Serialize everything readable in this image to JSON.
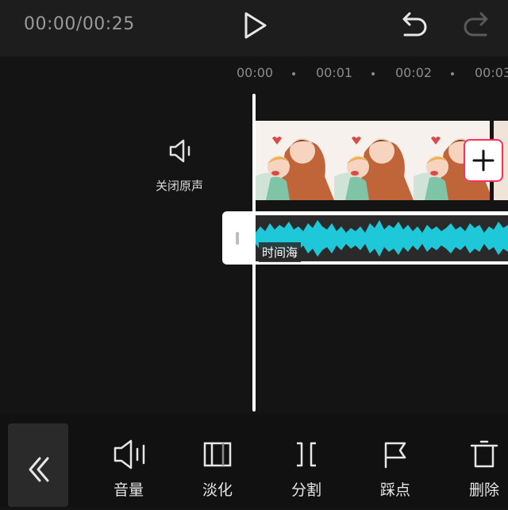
{
  "header": {
    "time_display": "00:00/00:25",
    "play_icon": "play-icon",
    "undo_icon": "undo-icon",
    "redo_icon": "redo-icon"
  },
  "ruler": {
    "ticks": [
      "00:00",
      "00:01",
      "00:02",
      "00:03"
    ]
  },
  "audio_control": {
    "icon": "speaker-icon",
    "label": "关闭原声"
  },
  "timeline": {
    "video_clip": {
      "frame_count": 3
    },
    "audio_clip": {
      "name": "时间海",
      "color": "#1ec8d8"
    }
  },
  "toolbar": {
    "back_icon": "double-chevron-left-icon",
    "items": [
      {
        "label": "音量",
        "icon": "volume-icon"
      },
      {
        "label": "淡化",
        "icon": "fade-icon"
      },
      {
        "label": "分割",
        "icon": "split-icon"
      },
      {
        "label": "踩点",
        "icon": "beat-flag-icon"
      },
      {
        "label": "删除",
        "icon": "delete-icon"
      }
    ]
  },
  "colors": {
    "background": "#141414",
    "topbar": "#1d1d1d",
    "waveform": "#1ec8d8",
    "add_border": "#ff2f5a"
  }
}
